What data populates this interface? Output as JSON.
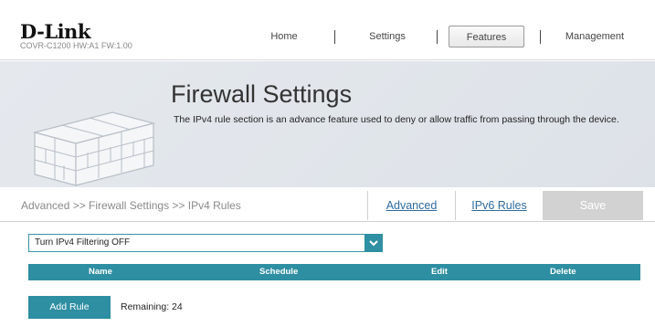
{
  "header": {
    "brand": "D-Link",
    "model": "COVR-C1200 HW:A1 FW:1.00",
    "nav": [
      {
        "label": "Home"
      },
      {
        "label": "Settings"
      },
      {
        "label": "Features",
        "active": true
      },
      {
        "label": "Management"
      }
    ]
  },
  "banner": {
    "title": "Firewall Settings",
    "description": "The IPv4 rule section is an advance feature used to deny or allow traffic from passing through the device."
  },
  "breadcrumb": "Advanced >> Firewall Settings >> IPv4 Rules",
  "tabs": {
    "advanced": "Advanced",
    "ipv6": "IPv6 Rules",
    "save": "Save"
  },
  "filter": {
    "selected": "Turn IPv4 Filtering OFF"
  },
  "table": {
    "columns": [
      "Name",
      "Schedule",
      "Edit",
      "Delete"
    ]
  },
  "add_rule": {
    "label": "Add Rule",
    "remaining": "Remaining: 24"
  },
  "colors": {
    "accent": "#2e8ea2",
    "link": "#2e6b9e",
    "disabled": "#d2d2d2"
  }
}
